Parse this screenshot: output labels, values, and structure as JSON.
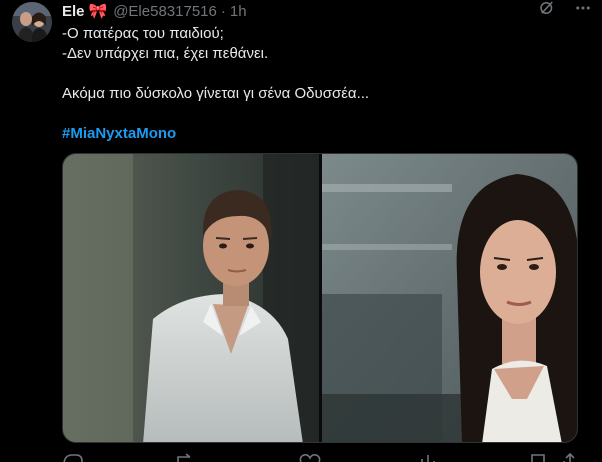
{
  "author": {
    "name": "Ele",
    "emoji": "🎀",
    "handle": "@Ele58317516",
    "separator": "·",
    "time": "1h"
  },
  "icons": {
    "header": [
      "grok-icon",
      "more-icon"
    ],
    "actions": [
      "reply-icon",
      "repost-icon",
      "like-icon",
      "views-icon",
      "bookmark-icon",
      "share-icon"
    ]
  },
  "tweet": {
    "line1": "-Ο πατέρας του παιδιού;",
    "line2": "-Δεν υπάρχει πια, έχει πεθάνει.",
    "line3": "Ακόμα πιο δύσκολο γίνεται γι σένα Οδυσσέα...",
    "hashtag": "#MiaNyxtaMono"
  },
  "colors": {
    "accent": "#1d9bf0",
    "background": "#000000",
    "text": "#e7e9ea",
    "muted": "#71767b"
  }
}
